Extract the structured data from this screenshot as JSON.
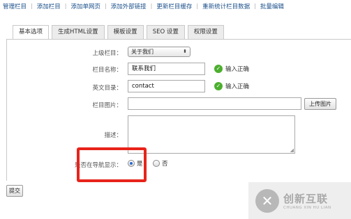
{
  "topnav": {
    "items": [
      "管理栏目",
      "添加栏目",
      "添加单网页",
      "添加外部链接",
      "更新栏目缓存",
      "重新统计栏目数据",
      "批量编辑"
    ]
  },
  "tabs": [
    "基本选项",
    "生成HTML设置",
    "模板设置",
    "SEO 设置",
    "权限设置"
  ],
  "active_tab": "基本选项",
  "form": {
    "parent": {
      "label": "上级栏目：",
      "value": "关于我们"
    },
    "name": {
      "label": "栏目名称：",
      "value": "联系我们",
      "status": "输入正确"
    },
    "dir": {
      "label": "英文目录：",
      "value": "contact",
      "status": "输入正确"
    },
    "image": {
      "label": "栏目图片：",
      "value": "",
      "button": "上传图片"
    },
    "desc": {
      "label": "描述："
    },
    "nav": {
      "label": "是否在导航显示：",
      "yes": "是",
      "no": "否",
      "selected": "是"
    }
  },
  "submit_label": "提交",
  "watermark": {
    "cn": "创新互联",
    "en": "CHUANG XIN HU LIAN"
  },
  "colors": {
    "link": "#1a4f8a",
    "ok": "#4caf2e",
    "highlight": "#e8231a"
  }
}
